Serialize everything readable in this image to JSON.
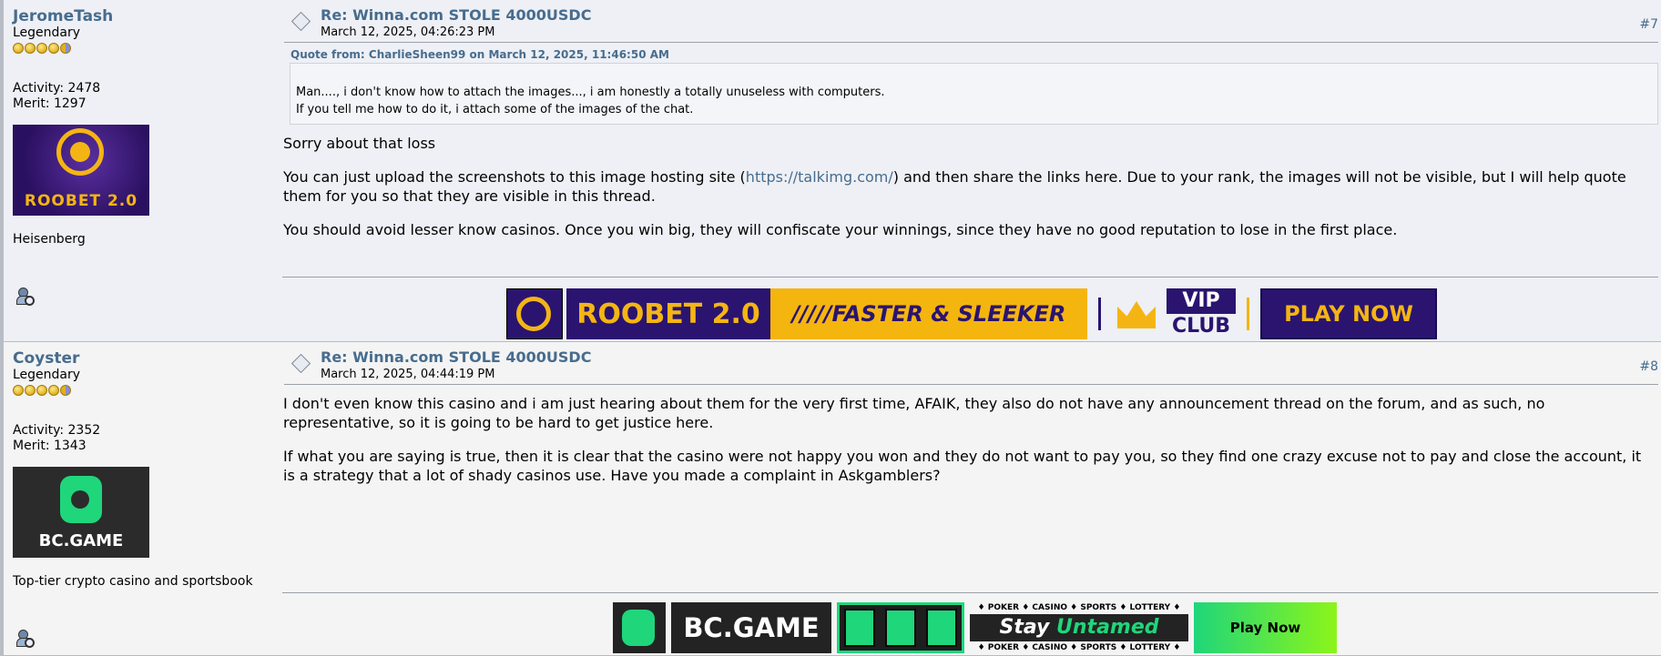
{
  "posts": [
    {
      "author": "JeromeTash",
      "rank": "Legendary",
      "activity": "Activity: 2478",
      "merit": "Merit: 1297",
      "avatar_text": "ROOBET 2.0",
      "personal_text": "Heisenberg",
      "subject": "Re: Winna.com STOLE 4000USDC",
      "date": "March 12, 2025, 04:26:23 PM",
      "number": "#7",
      "quote_header": "Quote from: CharlieSheen99 on March 12, 2025, 11:46:50 AM",
      "quote_lines": [
        "Man...., i don't know how to attach the images..., i am honestly a totally unuseless with computers.",
        "If you tell me how to do it, i attach some of the images of the chat."
      ],
      "para1": "Sorry about that loss",
      "para2_before": "You can just upload the screenshots to this image hosting site (",
      "para2_link": "https://talkimg.com/",
      "para2_after": ") and then share the links here. Due to your rank, the images will not be visible, but I will help quote them for you so that they are visible in this thread.",
      "para3": "You should avoid lesser know casinos. Once you win big, they will confiscate your winnings, since they have no good reputation to lose in the first place.",
      "banner": {
        "name": "ROOBET 2.0",
        "tagline": "/////FASTER & SLEEKER",
        "vip": "VIP",
        "club": "CLUB",
        "cta": "PLAY NOW"
      }
    },
    {
      "author": "Coyster",
      "rank": "Legendary",
      "activity": "Activity: 2352",
      "merit": "Merit: 1343",
      "avatar_text": "BC.GAME",
      "personal_text": "Top-tier crypto casino and sportsbook",
      "subject": "Re: Winna.com STOLE 4000USDC",
      "date": "March 12, 2025, 04:44:19 PM",
      "number": "#8",
      "para1": "I don't even know this casino and i am just hearing about them for the very first time, AFAIK, they also do not have any announcement thread on the forum, and as such, no representative, so it is going to be hard to get justice here.",
      "para2": "If what you are saying is true, then it is clear that the casino were not happy you won and they do not want to pay you, so they find one crazy excuse not to pay and close the account, it is a strategy that a lot of shady casinos use. Have you made a complaint in Askgamblers?",
      "banner": {
        "name": "BC.GAME",
        "tags": "♦ POKER ♦ CASINO ♦ SPORTS ♦ LOTTERY ♦",
        "stay": "Stay",
        "untamed": "Untamed",
        "cta": "Play Now"
      }
    }
  ]
}
